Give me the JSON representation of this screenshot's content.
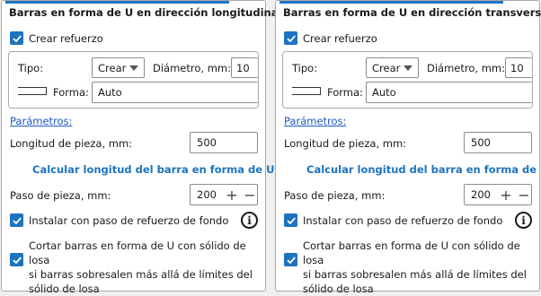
{
  "panels": [
    {
      "title": "Barras en forma de U en dirección longitudinal",
      "crear_refuerzo": "Crear refuerzo",
      "tipo_label": "Tipo:",
      "tipo_value": "Crear",
      "diametro_label": "Diámetro, mm:",
      "diametro_value": "10",
      "forma_label": "Forma:",
      "forma_value": "Auto",
      "parametros_link": "Parámetros:",
      "longitud_label": "Longitud de pieza, mm:",
      "longitud_value": "500",
      "calcular_label": "Calcular longitud del barra en forma de U",
      "paso_label": "Paso de pieza, mm:",
      "paso_value": "200",
      "instalar_label": "Instalar con paso de refuerzo de fondo",
      "cortar_line1": "Cortar barras en forma de U con sólido de losa",
      "cortar_line2": "si barras sobresalen más allá de límites del",
      "cortar_line3": "sólido de losa"
    },
    {
      "title": "Barras en forma de U en dirección transversal",
      "crear_refuerzo": "Crear refuerzo",
      "tipo_label": "Tipo:",
      "tipo_value": "Crear",
      "diametro_label": "Diámetro, mm:",
      "diametro_value": "10",
      "forma_label": "Forma:",
      "forma_value": "Auto",
      "parametros_link": "Parámetros:",
      "longitud_label": "Longitud de pieza, mm:",
      "longitud_value": "500",
      "calcular_label": "Calcular longitud del barra en forma de U",
      "paso_label": "Paso de pieza, mm:",
      "paso_value": "200",
      "instalar_label": "Instalar con paso de refuerzo de fondo",
      "cortar_line1": "Cortar barras en forma de U con sólido de losa",
      "cortar_line2": "si barras sobresalen más allá de límites del",
      "cortar_line3": "sólido de losa"
    }
  ],
  "icons": {
    "checkbox": "check-icon",
    "dropdown": "chevron-down-icon",
    "info": "info-icon",
    "plus": "plus-icon",
    "minus": "minus-icon",
    "shape": "u-shape-icon",
    "plus_glyph": "+",
    "minus_glyph": "−",
    "info_glyph": "i"
  },
  "colors": {
    "accent": "#1e73be",
    "link": "#1e5bbf",
    "border": "#a9a9a9"
  }
}
